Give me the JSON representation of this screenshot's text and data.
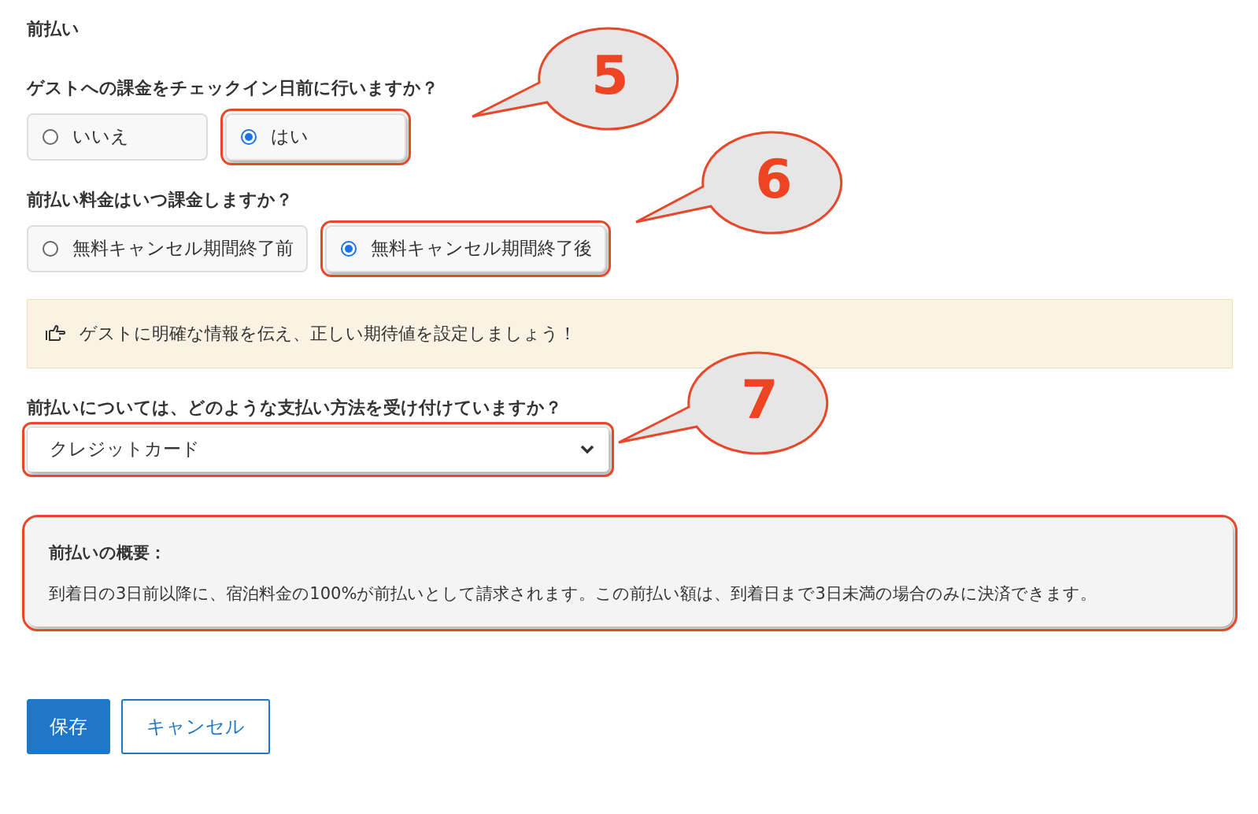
{
  "section_title": "前払い",
  "questions": [
    {
      "kind": "radio",
      "label": "ゲストへの課金をチェックイン日前に行いますか？",
      "options": [
        {
          "label": "いいえ",
          "selected": false,
          "highlighted": false
        },
        {
          "label": "はい",
          "selected": true,
          "highlighted": true
        }
      ]
    },
    {
      "kind": "radio",
      "label": "前払い料金はいつ課金しますか？",
      "options": [
        {
          "label": "無料キャンセル期間終了前",
          "selected": false,
          "highlighted": false
        },
        {
          "label": "無料キャンセル期間終了後",
          "selected": true,
          "highlighted": true
        }
      ]
    }
  ],
  "notice": {
    "text": "ゲストに明確な情報を伝え、正しい期待値を設定しましょう！"
  },
  "payment_method": {
    "label": "前払いについては、どのような支払い方法を受け付けていますか？",
    "value": "クレジットカード",
    "highlighted": true
  },
  "summary": {
    "title": "前払いの概要：",
    "text": "到着日の3日前以降に、宿泊料金の100%が前払いとして請求されます。この前払い額は、到着日まで3日未満の場合のみに決済できます。",
    "highlighted": true
  },
  "buttons": [
    {
      "label": "保存",
      "kind": "primary"
    },
    {
      "label": "キャンセル",
      "kind": "secondary"
    }
  ],
  "annotations": [
    {
      "label": "5"
    },
    {
      "label": "6"
    },
    {
      "label": "7"
    }
  ]
}
